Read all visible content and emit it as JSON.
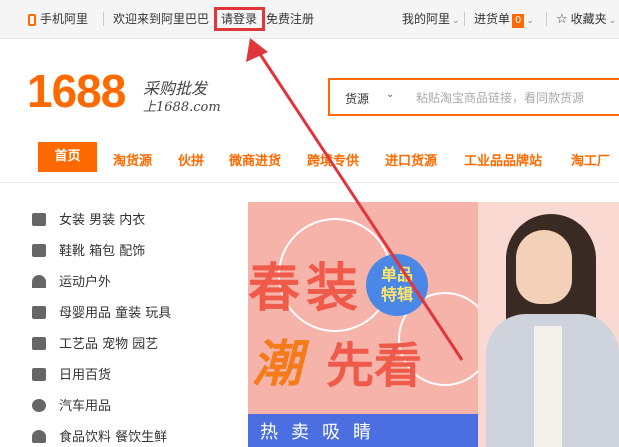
{
  "topbar": {
    "mobile": "手机阿里",
    "welcome": "欢迎来到阿里巴巴",
    "login": "请登录",
    "register": "免费注册",
    "my_ali": "我的阿里",
    "cart": "进货单",
    "cart_count": "0",
    "favorites": "收藏夹"
  },
  "logo": {
    "number": "1688",
    "tagline": "采购批发",
    "url": "上1688.com"
  },
  "search": {
    "type": "货源",
    "placeholder": "粘贴淘宝商品链接，看同款货源"
  },
  "nav": {
    "items": [
      "首页",
      "淘货源",
      "伙拼",
      "微商进货",
      "跨境专供",
      "进口货源",
      "工业品品牌站",
      "淘工厂"
    ]
  },
  "categories": [
    {
      "label": "女装 男装 内衣",
      "icon": "clothing-icon"
    },
    {
      "label": "鞋靴 箱包 配饰",
      "icon": "boot-icon"
    },
    {
      "label": "运动户外",
      "icon": "tent-icon"
    },
    {
      "label": "母婴用品 童装 玩具",
      "icon": "baby-bottle-icon"
    },
    {
      "label": "工艺品 宠物 园艺",
      "icon": "craft-icon"
    },
    {
      "label": "日用百货",
      "icon": "cup-icon"
    },
    {
      "label": "汽车用品",
      "icon": "wheel-icon"
    },
    {
      "label": "食品饮料 餐饮生鲜",
      "icon": "food-icon"
    }
  ],
  "banner": {
    "spring": "春装",
    "trend": "潮",
    "first_look": "先看",
    "badge": "单品特辑",
    "hot": "热卖吸睛"
  },
  "colors": {
    "accent": "#ff6a00",
    "annotation": "#e0353b",
    "banner_bg": "#f4a9a0",
    "banner_blue": "#4b6fe0"
  }
}
